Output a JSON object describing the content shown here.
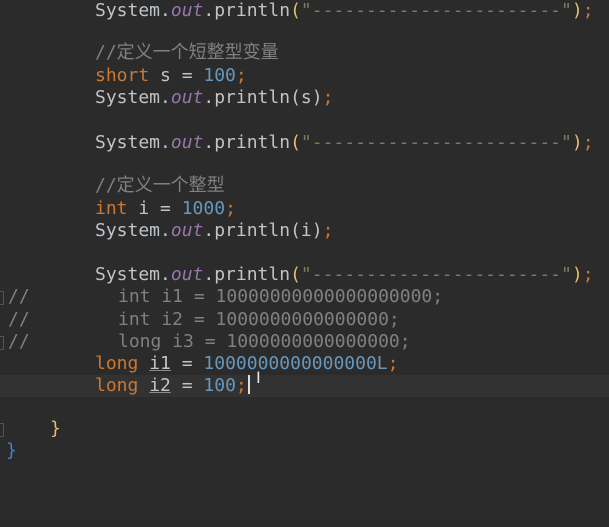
{
  "code": {
    "l1": {
      "obj": "System.",
      "field": "out",
      "dot": ".println",
      "open": "(",
      "str": "\"-----------------------\"",
      "close": ")",
      "semi": ";"
    },
    "comment_short": "//定义一个短整型变量",
    "short_decl": {
      "kw": "short",
      "rest": " s = ",
      "num": "100",
      "semi": ";"
    },
    "print_s": {
      "obj": "System.",
      "field": "out",
      "dot": ".println",
      "open": "(",
      "arg": "s",
      "close": ")",
      "semi": ";"
    },
    "l5": {
      "obj": "System.",
      "field": "out",
      "dot": ".println",
      "open": "(",
      "str": "\"-----------------------\"",
      "close": ")",
      "semi": ";"
    },
    "comment_int": "//定义一个整型",
    "int_decl": {
      "kw": "int",
      "rest": " i = ",
      "num": "1000",
      "semi": ";"
    },
    "print_i": {
      "obj": "System.",
      "field": "out",
      "dot": ".println",
      "open": "(",
      "arg": "i",
      "close": ")",
      "semi": ";"
    },
    "l9": {
      "obj": "System.",
      "field": "out",
      "dot": ".println",
      "open": "(",
      "str": "\"-----------------------\"",
      "close": ")",
      "semi": ";"
    },
    "commented1": {
      "marker": "//",
      "text": "int i1 = 10000000000000000000;"
    },
    "commented2": {
      "marker": "//",
      "text": "int i2 = 1000000000000000;"
    },
    "commented3": {
      "marker": "//",
      "text": "long i3 = 1000000000000000;"
    },
    "long1": {
      "kw": "long",
      "sp": " ",
      "var": "i1",
      "rest": " = ",
      "num": "1000000000000000L",
      "semi": ";"
    },
    "long2": {
      "kw": "long",
      "sp": " ",
      "var": "i2",
      "rest": " = ",
      "num": "100",
      "semi": ";"
    },
    "brace_inner": "}",
    "brace_outer": "}"
  },
  "colors": {
    "background": "#2b2b2b",
    "keyword": "#cc7832",
    "number": "#6897bb",
    "string": "#6a8759",
    "static_field": "#9876aa",
    "comment": "#808080"
  }
}
